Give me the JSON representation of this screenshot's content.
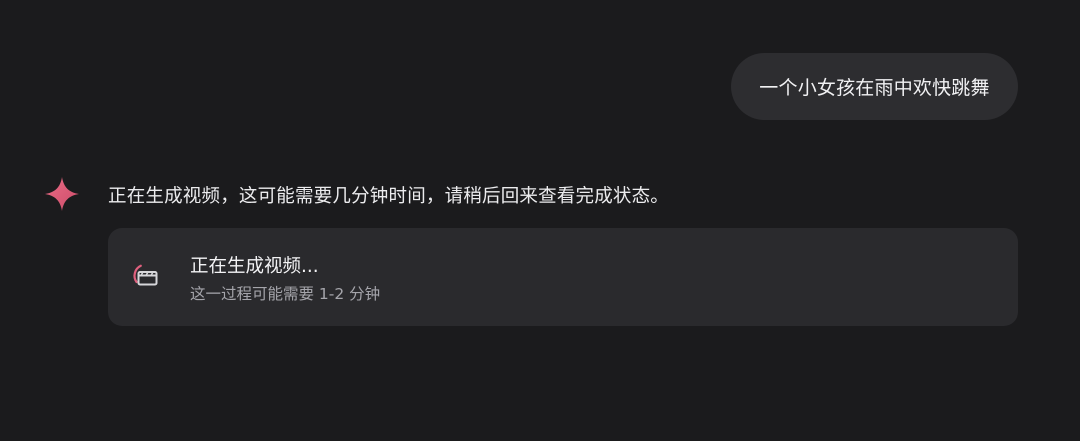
{
  "conversation": {
    "user_message": "一个小女孩在雨中欢快跳舞",
    "assistant_message": "正在生成视频，这可能需要几分钟时间，请稍后回来查看完成状态。"
  },
  "generation_card": {
    "title": "正在生成视频...",
    "subtitle": "这一过程可能需要 1-2 分钟",
    "icon": "video-generation-progress-icon"
  },
  "assistant": {
    "icon": "sparkle-icon"
  },
  "colors": {
    "background": "#1b1b1d",
    "user_bubble": "#2d2d30",
    "card": "#2a2a2d",
    "accent": "#e0607e"
  }
}
